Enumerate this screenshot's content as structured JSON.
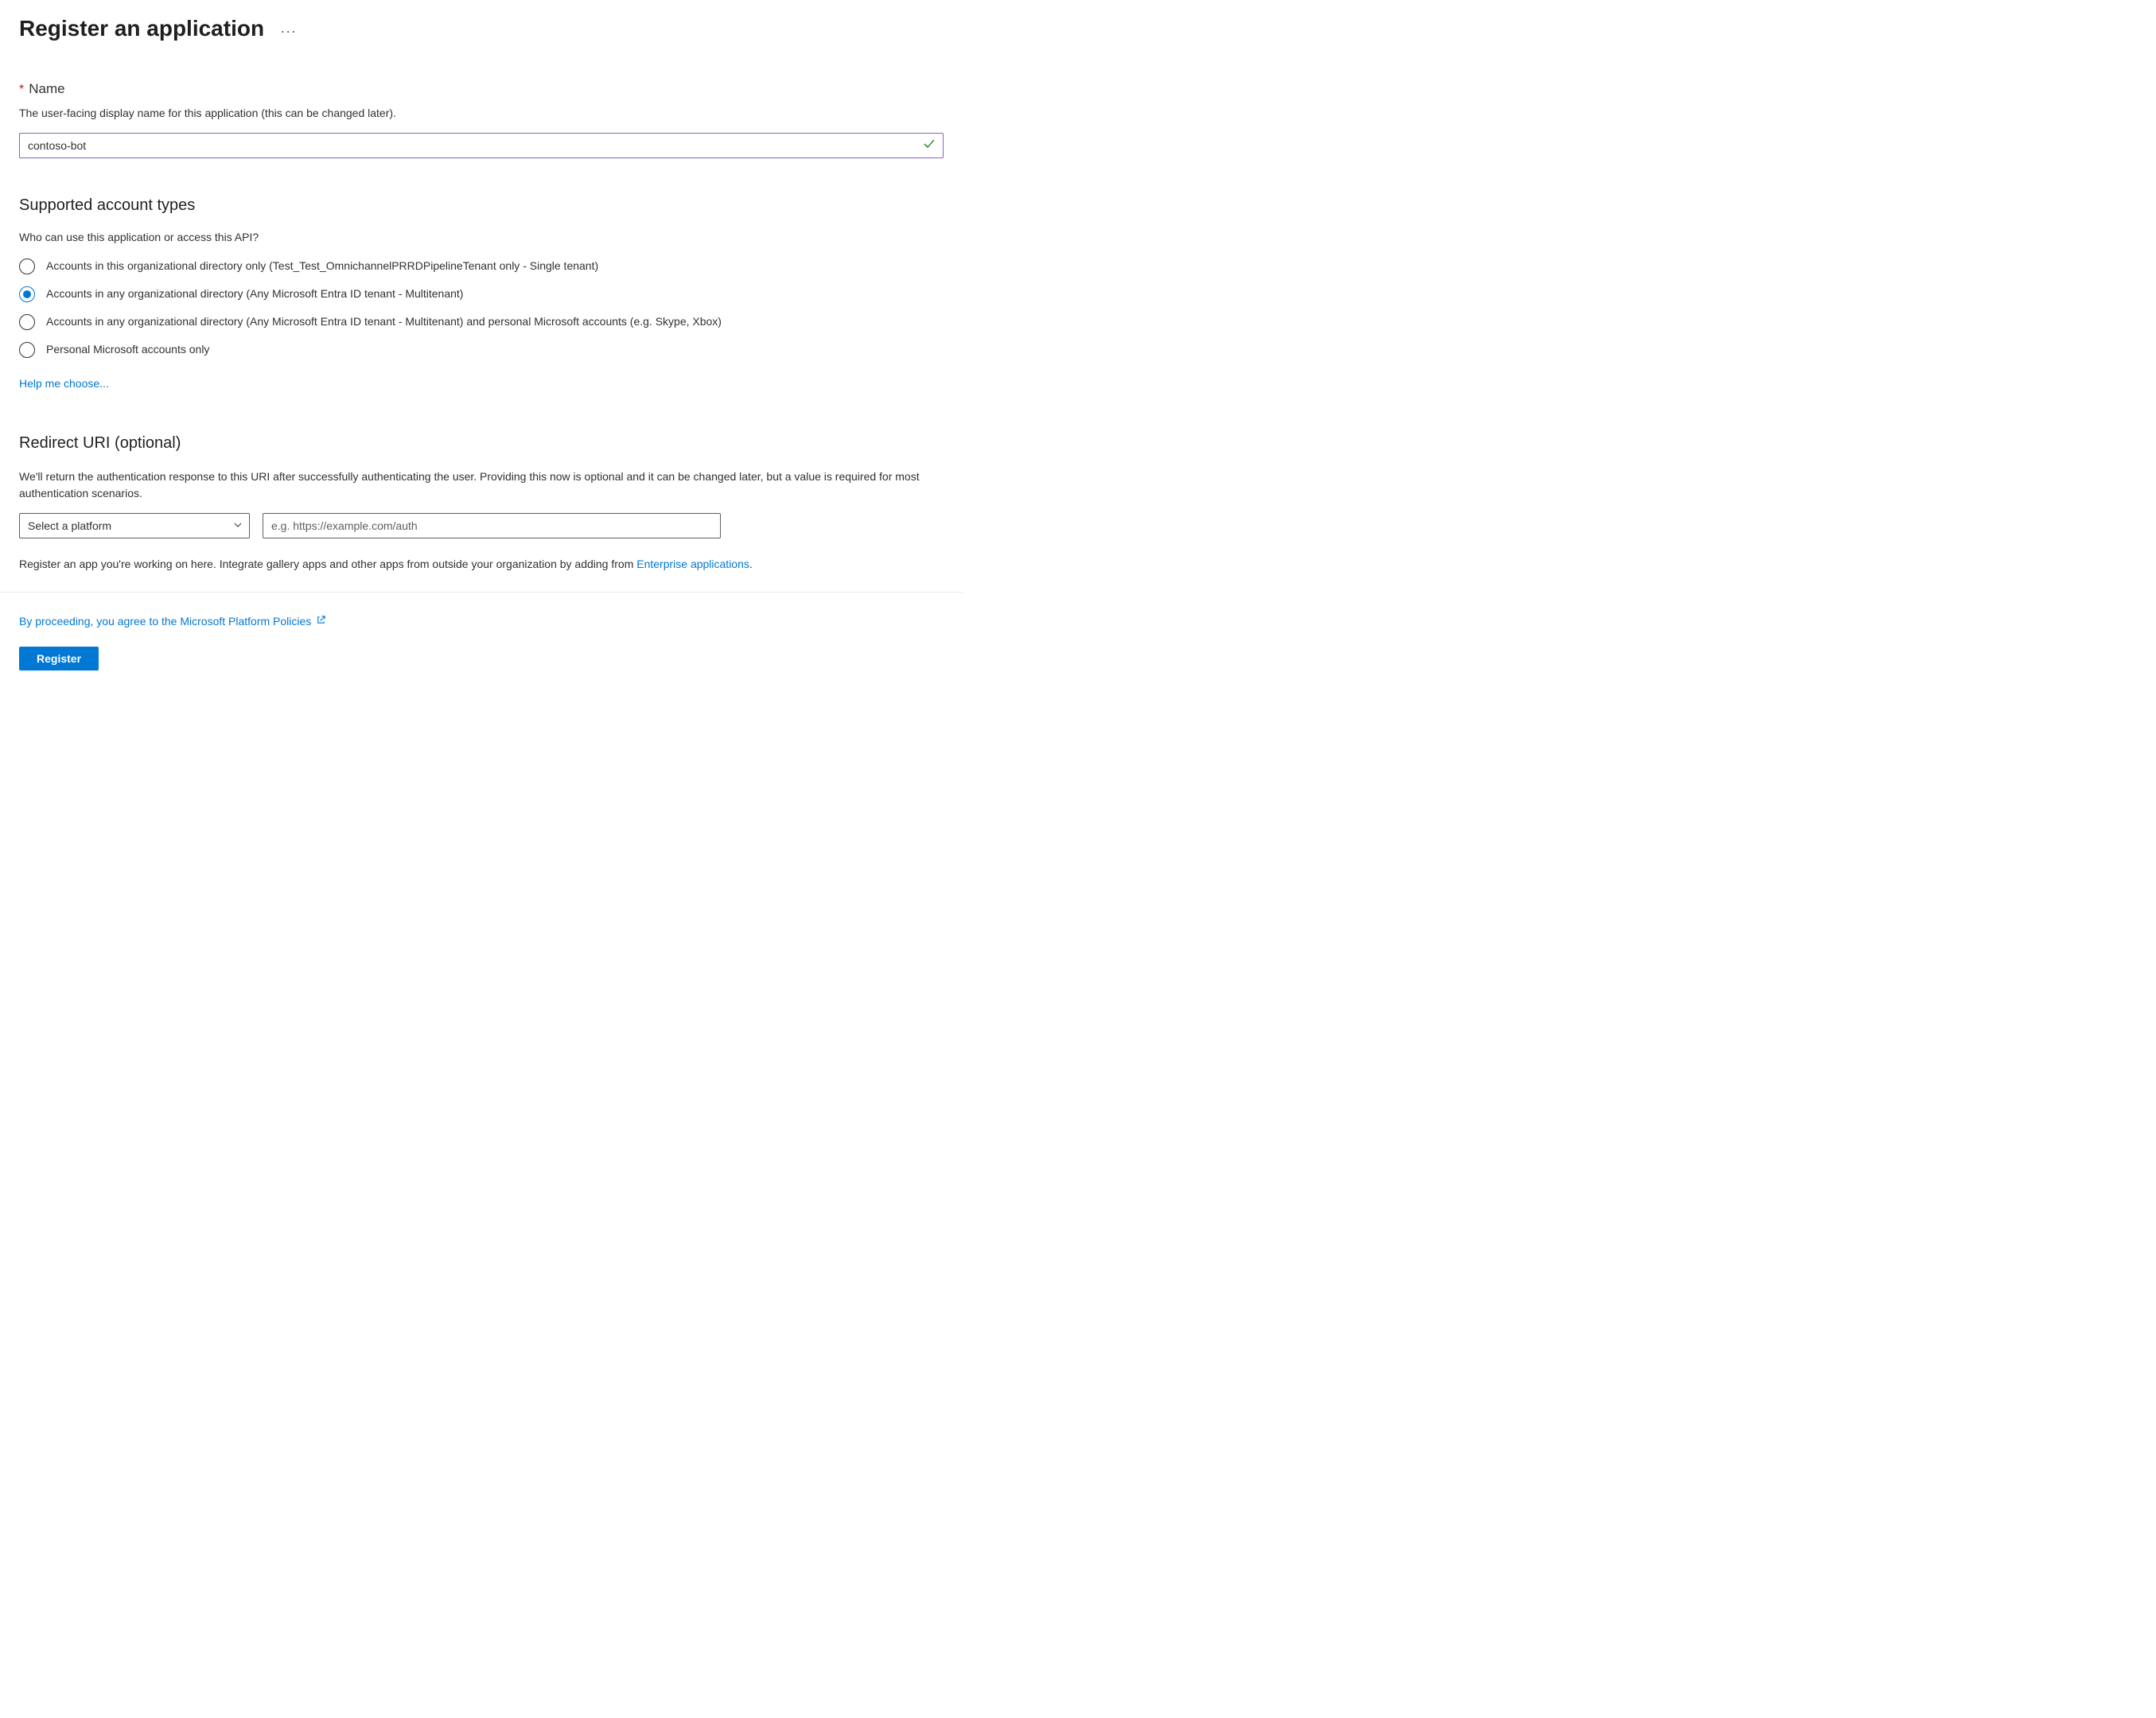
{
  "header": {
    "title": "Register an application"
  },
  "name_section": {
    "label": "Name",
    "help_text": "The user-facing display name for this application (this can be changed later).",
    "value": "contoso-bot"
  },
  "account_types": {
    "heading": "Supported account types",
    "question": "Who can use this application or access this API?",
    "options": [
      "Accounts in this organizational directory only (Test_Test_OmnichannelPRRDPipelineTenant only - Single tenant)",
      "Accounts in any organizational directory (Any Microsoft Entra ID tenant - Multitenant)",
      "Accounts in any organizational directory (Any Microsoft Entra ID tenant - Multitenant) and personal Microsoft accounts (e.g. Skype, Xbox)",
      "Personal Microsoft accounts only"
    ],
    "selected_index": 1,
    "help_link": "Help me choose..."
  },
  "redirect": {
    "heading": "Redirect URI (optional)",
    "help_text": "We'll return the authentication response to this URI after successfully authenticating the user. Providing this now is optional and it can be changed later, but a value is required for most authentication scenarios.",
    "platform_placeholder": "Select a platform",
    "uri_placeholder": "e.g. https://example.com/auth",
    "integrate_text_prefix": "Register an app you're working on here. Integrate gallery apps and other apps from outside your organization by adding from ",
    "enterprise_link": "Enterprise applications",
    "integrate_text_suffix": "."
  },
  "footer": {
    "policies_text": "By proceeding, you agree to the Microsoft Platform Policies",
    "register_label": "Register"
  }
}
